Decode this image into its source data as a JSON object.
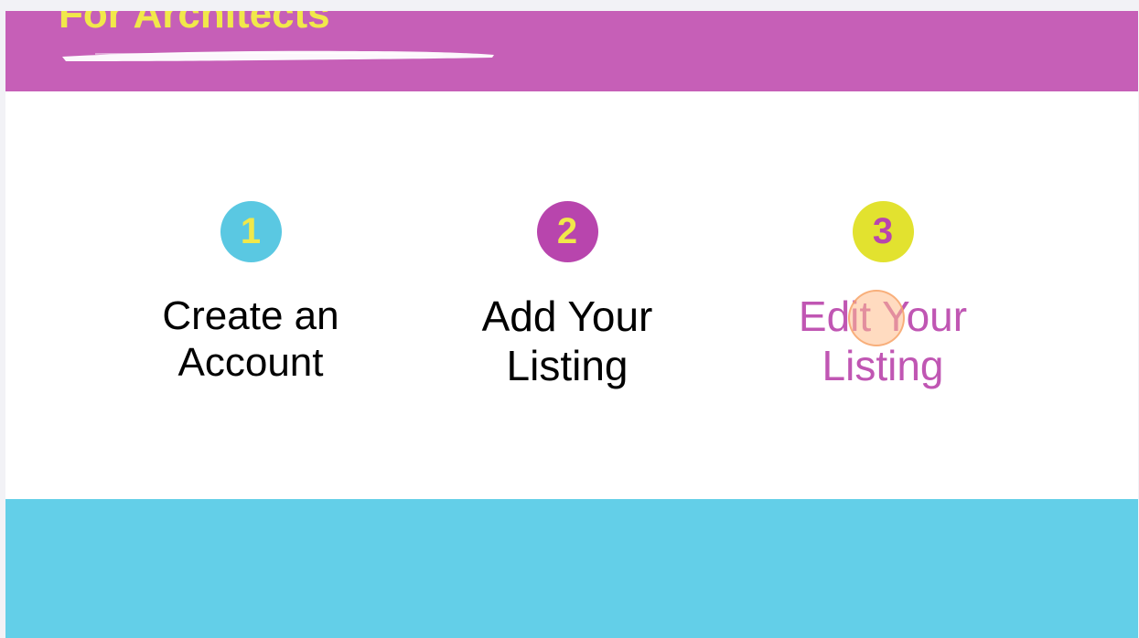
{
  "hero": {
    "title": "For Architects"
  },
  "steps": [
    {
      "number": "1",
      "label_line1": "Create an",
      "label_line2": "Account",
      "circle_color": "#5ac8e2",
      "number_color": "#f1e84a"
    },
    {
      "number": "2",
      "label_line1": "Add Your",
      "label_line2": "Listing",
      "circle_color": "#b845ad",
      "number_color": "#f1e84a"
    },
    {
      "number": "3",
      "label_line1": "Edit Your",
      "label_line2": "Listing",
      "circle_color": "#e2e22f",
      "number_color": "#b845ad"
    }
  ],
  "colors": {
    "hero_background": "#c65fb7",
    "hero_title": "#f1e84a",
    "highlight_label": "#c056b3",
    "bottom_band": "#63cfe8"
  }
}
